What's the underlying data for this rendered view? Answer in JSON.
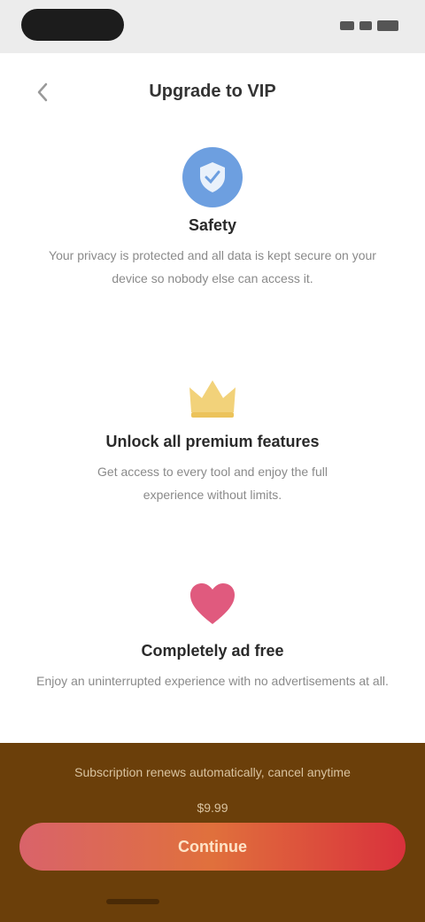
{
  "header": {
    "back_icon": "chevron-left-icon",
    "title": "Upgrade to VIP"
  },
  "features": [
    {
      "icon": "shield-icon",
      "color": "#6d9fe0",
      "title": "Safety",
      "description": "Your privacy is protected and all data is kept secure on your device so nobody else can access it."
    },
    {
      "icon": "crown-icon",
      "color": "#f2d27a",
      "title": "Unlock all premium features",
      "description": "Get access to every tool and enjoy the full experience without limits."
    },
    {
      "icon": "heart-icon",
      "color": "#e05a7e",
      "title": "Completely ad free",
      "description": "Enjoy an uninterrupted experience with no advertisements at all."
    }
  ],
  "bottom": {
    "note": "Subscription renews automatically, cancel anytime",
    "price": "$9.99",
    "cta_label": "Continue"
  },
  "colors": {
    "accent_start": "#d9636a",
    "accent_end": "#d9313c",
    "panel": "#6b3f0a"
  }
}
